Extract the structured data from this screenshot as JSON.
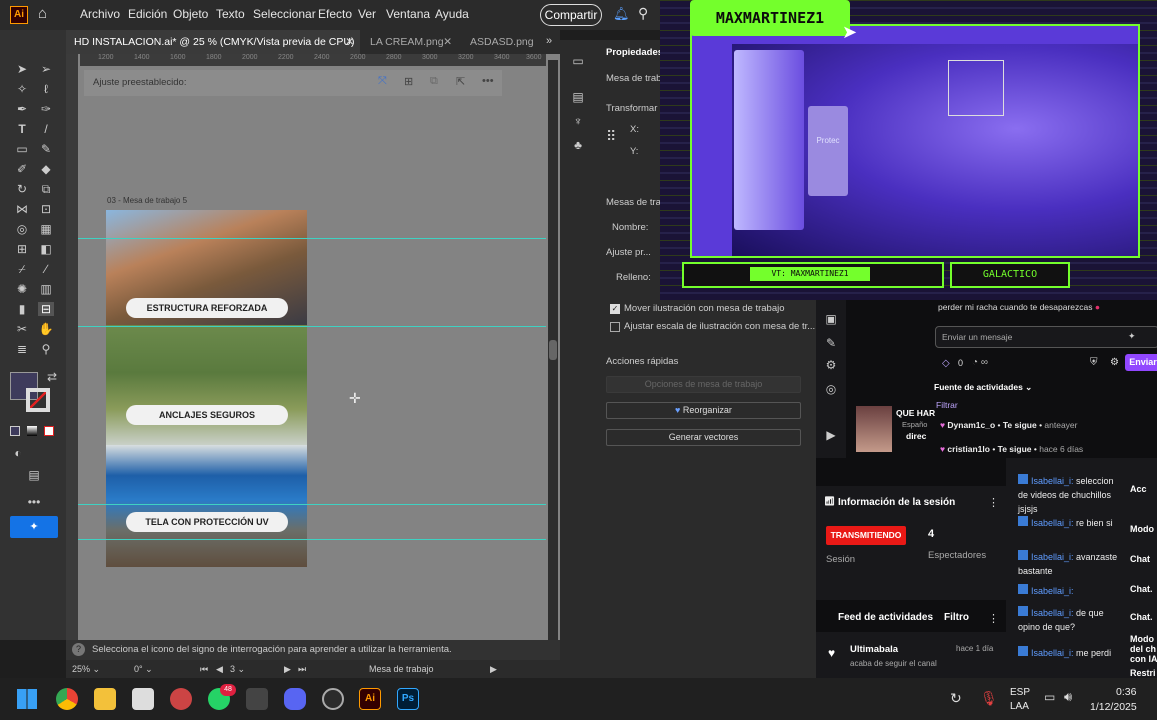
{
  "menubar": {
    "logo": "Ai",
    "items": [
      "Archivo",
      "Edición",
      "Objeto",
      "Texto",
      "Seleccionar",
      "Efecto",
      "Ver",
      "Ventana",
      "Ayuda"
    ],
    "share_label": "Compartir"
  },
  "tabs": [
    {
      "label": "HD INSTALACION.ai* @ 25 % (CMYK/Vista previa de CPU)"
    },
    {
      "label": "LA CREAM.png"
    },
    {
      "label": "ASDASD.png"
    }
  ],
  "ruler_ticks": [
    "1200",
    "1400",
    "1600",
    "1800",
    "2000",
    "2200",
    "2400",
    "2600",
    "2800",
    "3000",
    "3200",
    "3400",
    "3600"
  ],
  "canvas": {
    "preset_label": "Ajuste preestablecido:",
    "artboard_label": "03 - Mesa de trabajo 5",
    "banners": [
      "ESTRUCTURA REFORZADA",
      "ANCLAJES SEGUROS",
      "TELA CON PROTECCIÓN UV"
    ]
  },
  "status": {
    "hint": "Selecciona el icono del signo de interrogación para aprender a utilizar la herramienta.",
    "zoom": "25%",
    "angle": "0°",
    "page": "3",
    "mode": "Mesa de trabajo"
  },
  "properties": {
    "title": "Propiedades",
    "mesa": "Mesa de trab",
    "transform": "Transformar",
    "x_label": "X:",
    "y_label": "Y:",
    "mesas": "Mesas de trab",
    "nombre": "Nombre:",
    "ajuste": "Ajuste pr...",
    "relleno": "Relleno:",
    "check1": "Mover ilustración con mesa de trabajo",
    "check2": "Ajustar escala de ilustración con mesa de tr...",
    "acciones": "Acciones rápidas",
    "btn_opciones": "Opciones de mesa de trabajo",
    "btn_reorganizar": "Reorganizar",
    "btn_generar": "Generar vectores"
  },
  "stream": {
    "name": "MAXMARTINEZ1",
    "vt": "VT: MAXMARTINEZ1",
    "gal": "GALACTICO",
    "mouse": "Protec"
  },
  "chat": {
    "top_msg": "perder mi racha cuando te desaparezcas",
    "placeholder": "Enviar un mensaje",
    "points": "0",
    "send": "Enviar",
    "feed_title": "Fuente de actividades",
    "filter": "Filtrar",
    "video_title": "QUE HAR",
    "video_lang": "Españo",
    "video_sub": "direc",
    "events": [
      {
        "user": "Dynam1c_o",
        "action": "Te sigue",
        "time": "anteayer"
      },
      {
        "user": "cristian1lo",
        "action": "Te sigue",
        "time": "hace 6 días"
      }
    ]
  },
  "session": {
    "title": "Información de la sesión",
    "live": "TRANSMITIENDO",
    "viewers": "4",
    "viewers_label": "Espectadores",
    "session_label": "Sesión",
    "feed": "Feed de actividades",
    "filter": "Filtro",
    "follower": "Ultimabala",
    "follower_action": "acaba de seguir el canal",
    "follower_time": "hace 1 día"
  },
  "chat2": [
    {
      "user": "Isabellai_i:",
      "text": "seleccion de videos de chuchillos jsjsjs"
    },
    {
      "user": "Isabellai_i:",
      "text": "re bien si"
    },
    {
      "user": "Isabellai_i:",
      "text": "avanzaste bastante"
    },
    {
      "user": "Isabellai_i:",
      "text": ""
    },
    {
      "user": "Isabellai_i:",
      "text": "de que opino de que?"
    },
    {
      "user": "Isabellai_i:",
      "text": "me perdi"
    }
  ],
  "farright": [
    "Acc",
    "Modo",
    "Chat",
    "Chat.",
    "Chat.",
    "Modo del ch con IA",
    "Restri"
  ],
  "taskbar": {
    "lang1": "ESP",
    "lang2": "LAA",
    "time": "0:36",
    "date": "1/12/2025",
    "badge": "48"
  },
  "colors": {
    "accent_green": "#74ff2c",
    "twitch_purple": "#9147ff",
    "live_red": "#e91916",
    "guide": "#3fd1c2"
  }
}
